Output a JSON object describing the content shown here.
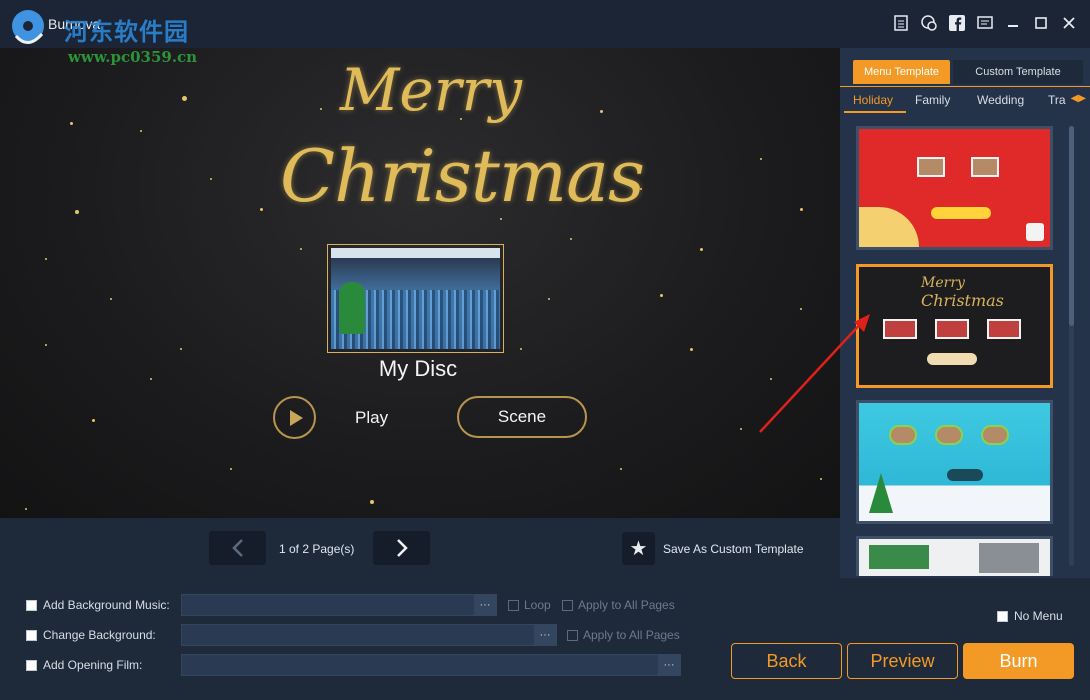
{
  "app": {
    "title": "Burnova"
  },
  "watermark": {
    "line1": "河东软件园",
    "line2": "www.pc0359.cn"
  },
  "titlebar": {
    "icons": [
      "document-icon",
      "chat-icon",
      "facebook-icon",
      "feedback-icon",
      "minimize-icon",
      "maximize-icon",
      "close-icon"
    ]
  },
  "preview": {
    "headline_1": "Merry",
    "headline_2": "Christmas",
    "disc_title": "My Disc",
    "play_label": "Play",
    "scene_label": "Scene"
  },
  "pager": {
    "page_text": "1 of 2 Page(s)",
    "prev_icon": "‹",
    "next_icon": "›",
    "save_custom_label": "Save As Custom Template",
    "star_icon": "★"
  },
  "right_panel": {
    "tabs": [
      "Menu Template",
      "Custom Template"
    ],
    "active_tab": "Menu Template",
    "categories": [
      "Holiday",
      "Family",
      "Wedding",
      "Tra"
    ],
    "active_category": "Holiday",
    "selected_template_index": 1
  },
  "options": {
    "bg_music": {
      "label": "Add Background Music:",
      "loop": "Loop",
      "apply": "Apply to All Pages"
    },
    "bg_change": {
      "label": "Change Background:",
      "apply": "Apply to All Pages"
    },
    "opening_film": {
      "label": "Add Opening Film:"
    },
    "dots": "···",
    "no_menu": "No Menu"
  },
  "buttons": {
    "back": "Back",
    "preview": "Preview",
    "burn": "Burn"
  },
  "colors": {
    "accent": "#f39a26",
    "gold": "#d9b45c",
    "panel": "#24334a",
    "bg": "#1e2a3a"
  }
}
